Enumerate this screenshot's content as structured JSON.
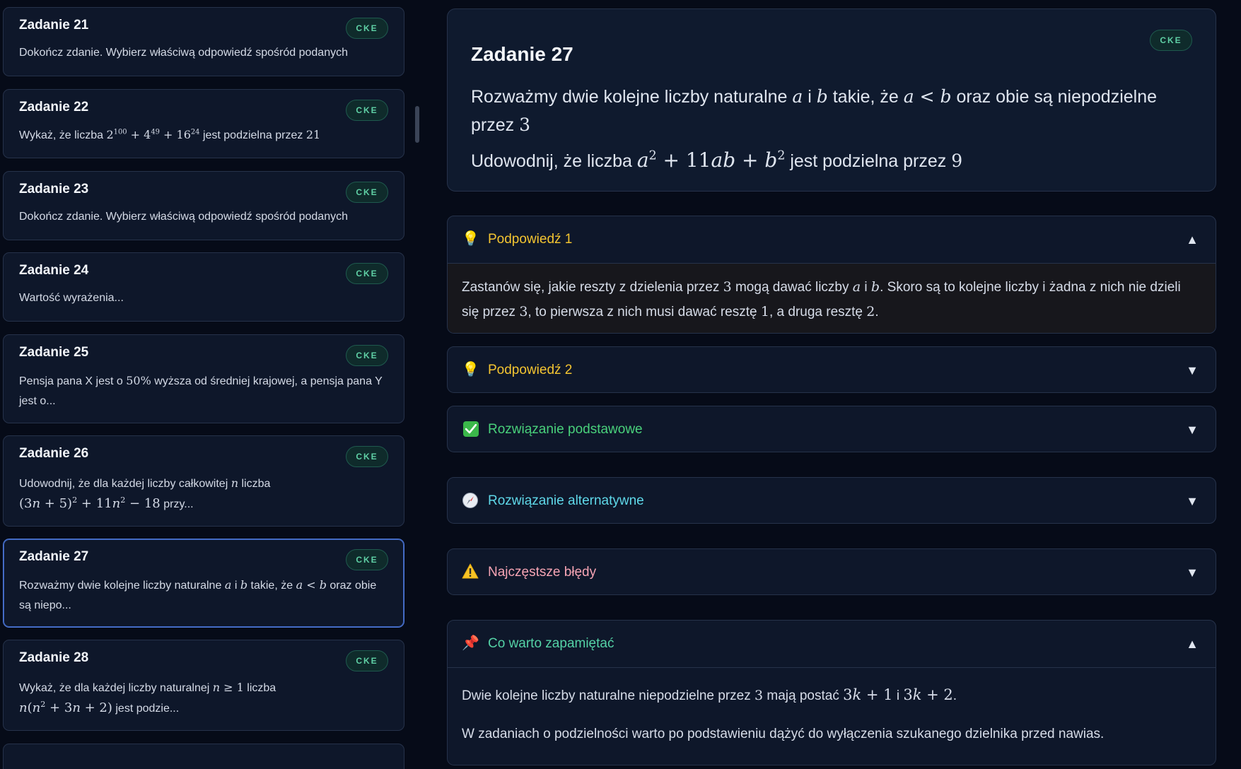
{
  "sidebar": {
    "badge": "CKE",
    "cards": [
      {
        "title": "Zadanie 21",
        "desc": "Dokończ zdanie. Wybierz właściwą odpowiedź spośród podanych"
      },
      {
        "title": "Zadanie 22",
        "desc_pre": "Wykaż, że liczba",
        "desc_post": "jest podzielna przez"
      },
      {
        "title": "Zadanie 23",
        "desc": "Dokończ zdanie. Wybierz właściwą odpowiedź spośród podanych"
      },
      {
        "title": "Zadanie 24",
        "desc": "Wartość wyrażenia..."
      },
      {
        "title": "Zadanie 25",
        "desc_pre": "Pensja pana X jest o",
        "desc_pct": "50%",
        "desc_post": "wyższa od średniej krajowej, a pensja pana Y jest o..."
      },
      {
        "title": "Zadanie 26",
        "desc_pre": "Udowodnij, że dla każdej liczby całkowitej",
        "desc_mid": "liczba",
        "desc_post": "przy..."
      },
      {
        "title": "Zadanie 27",
        "desc_pre": "Rozważmy dwie kolejne liczby naturalne",
        "desc_and": "i",
        "desc_mid": "takie, że",
        "desc_post": "oraz obie są niepo..."
      },
      {
        "title": "Zadanie 28",
        "desc_pre": "Wykaż, że dla każdej liczby naturalnej",
        "desc_mid": "liczba",
        "desc_post": "jest podzie..."
      }
    ]
  },
  "problem": {
    "title": "Zadanie 27",
    "badge": "CKE",
    "line1_a": "Rozważmy dwie kolejne liczby naturalne",
    "line1_b": "i",
    "line1_c": "takie, że",
    "line1_d": "oraz obie są niepodzielne przez",
    "line2_a": "Udowodnij, że liczba",
    "line2_b": "jest podzielna przez"
  },
  "accordions": {
    "hint1": {
      "label": "Podpowiedź 1",
      "arrow": "▲",
      "body_1": "Zastanów się, jakie reszty z dzielenia przez",
      "body_2": "mogą dawać liczby",
      "body_3": "i",
      "body_4": ". Skoro są to kolejne liczby i żadna z nich nie dzieli się przez",
      "body_5": ", to pierwsza z nich musi dawać resztę",
      "body_6": ", a druga resztę"
    },
    "hint2": {
      "label": "Podpowiedź 2",
      "arrow": "▼"
    },
    "basic": {
      "label": "Rozwiązanie podstawowe",
      "arrow": "▼"
    },
    "alt": {
      "label": "Rozwiązanie alternatywne",
      "arrow": "▼"
    },
    "errors": {
      "label": "Najczęstsze błędy",
      "arrow": "▼"
    },
    "remember": {
      "label": "Co warto zapamiętać",
      "arrow": "▲",
      "p1_a": "Dwie kolejne liczby naturalne niepodzielne przez",
      "p1_b": "mają postać",
      "p1_c": "i",
      "p2": "W zadaniach o podzielności warto po podstawieniu dążyć do wyłączenia szukanego dzielnika przed nawias."
    }
  },
  "colors": {
    "background": "#060b18",
    "card": "#0e172a",
    "badge_text": "#5fd0a5",
    "hint": "#f4c531",
    "solution": "#49d17b",
    "alternative": "#5fd8e9",
    "errors": "#f6a4b4",
    "remember": "#54d2a6",
    "active_border": "#4e78d8"
  },
  "icons": {
    "hint": "lightbulb-icon",
    "basic": "check-mark-icon",
    "alt": "compass-icon",
    "errors": "warning-icon",
    "remember": "pushpin-icon"
  }
}
